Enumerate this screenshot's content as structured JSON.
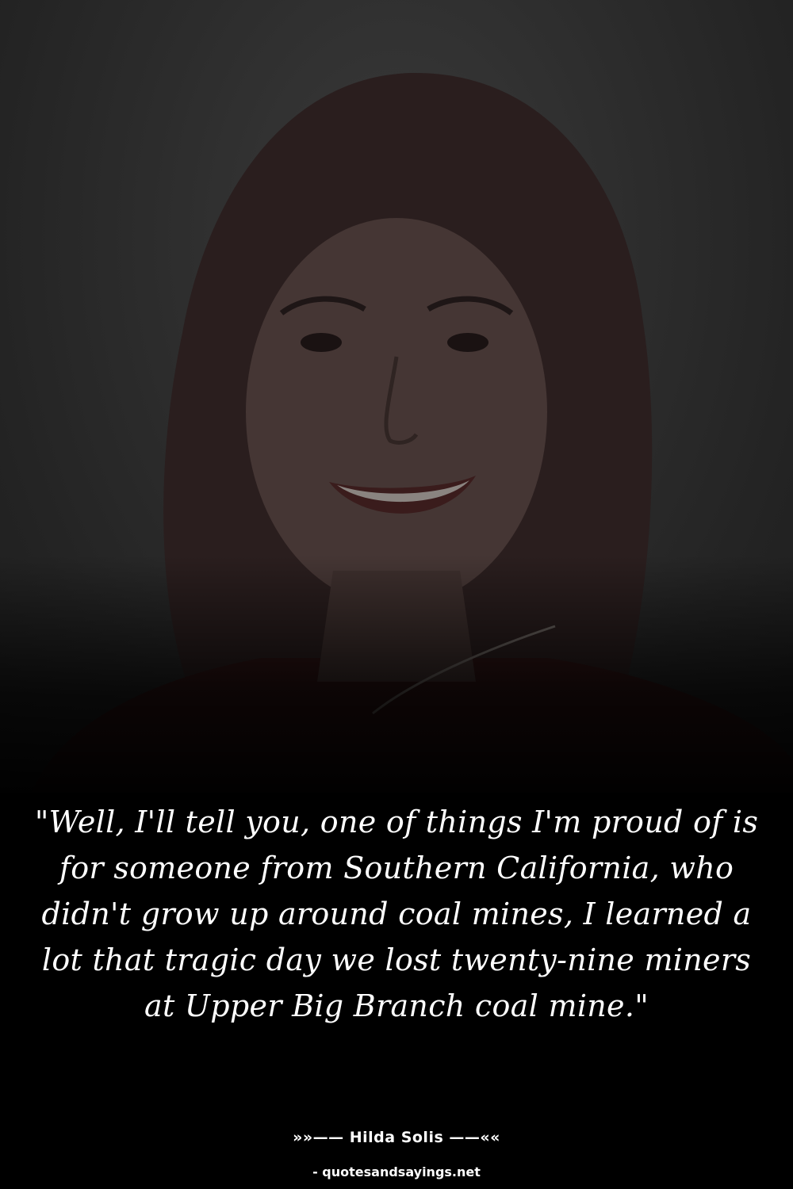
{
  "quote": {
    "text": "\"Well, I'll tell you, one of things I'm proud of is for someone from Southern California, who didn't grow up around coal mines, I learned a lot that tragic day we lost twenty-nine miners at Upper Big Branch coal mine.\""
  },
  "attribution": {
    "author_line": "»»—— Hilda Solis ——««"
  },
  "source": {
    "text": "- quotesandsayings.net"
  },
  "colors": {
    "background": "#000000",
    "text": "#ffffff",
    "portrait_tone": "#2c2c2c"
  }
}
